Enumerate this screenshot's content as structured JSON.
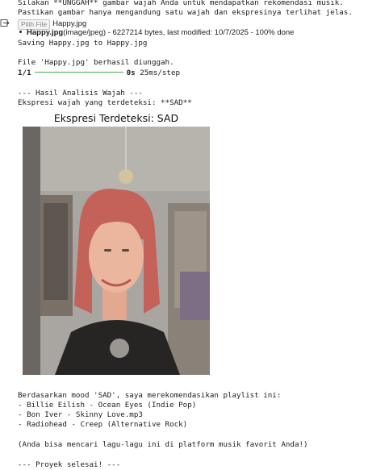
{
  "output": {
    "intro_line1": "Silakan **UNGGAH** gambar wajah Anda untuk mendapatkan rekomendasi musik.",
    "intro_line2": "Pastikan gambar hanya mengandung satu wajah dan ekspresinya terlihat jelas.",
    "file_button": "Pilih File",
    "file_chosen": "Happy.jpg",
    "upload_name": "Happy.jpg",
    "upload_meta": "(image/jpeg) - 6227214 bytes, last modified: 10/7/2025 - 100% done",
    "saving": "Saving Happy.jpg to Happy.jpg",
    "uploaded_msg": "File 'Happy.jpg' berhasil diunggah.",
    "progress_count": "1/1",
    "progress_time": "0s",
    "progress_step": "25ms/step",
    "progress_fraction": 1.0,
    "analysis_header": "--- Hasil Analisis Wajah ---",
    "expression_line": "Ekspresi wajah yang terdeteksi: **SAD**",
    "figure_title": "Ekspresi Terdeteksi: SAD",
    "reco_intro": "Berdasarkan mood 'SAD', saya merekomendasikan playlist ini:",
    "songs": [
      "- Billie Eilish - Ocean Eyes (Indie Pop)",
      "- Bon Iver - Skinny Love.mp3",
      "- Radiohead - Creep (Alternative Rock)"
    ],
    "note": "(Anda bisa mencari lagu-lagu ini di platform musik favorit Anda!)",
    "footer": "--- Proyek selesai! ---"
  },
  "colors": {
    "progress_bar": "#4caf50",
    "hair": "#c4625a"
  }
}
